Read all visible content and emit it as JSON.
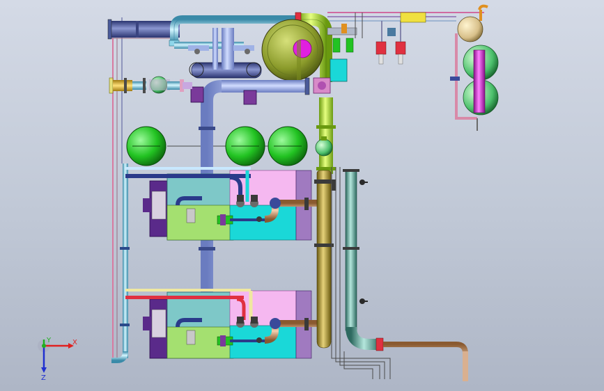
{
  "viewport": {
    "background_top": "#d4dae6",
    "background_bottom": "#aeb6c6"
  },
  "triad": {
    "x_label": "X",
    "y_label": "Y",
    "z_label": "Z",
    "x_color": "#e02020",
    "y_color": "#20b020",
    "z_color": "#2030d0"
  },
  "colors": {
    "pipe_blue": "#9fb2e6",
    "pipe_cyan": "#8fd6ea",
    "pipe_yellow_green": "#bde23a",
    "pipe_olive": "#b8a83a",
    "pipe_teal": "#6aa69a",
    "pipe_copper": "#c99870",
    "pipe_pink": "#d88aa8",
    "pipe_red": "#e03040",
    "tank_green": "#22c322",
    "drum_olive": "#8a9a2a",
    "magenta": "#e020e0",
    "pink_block": "#f5b8f0",
    "cyan_block": "#1ad8d8",
    "light_green_block": "#a4e070",
    "purple": "#7a3a9a",
    "dark_blue": "#4a5a9a",
    "light_purple": "#c8a8e0"
  }
}
